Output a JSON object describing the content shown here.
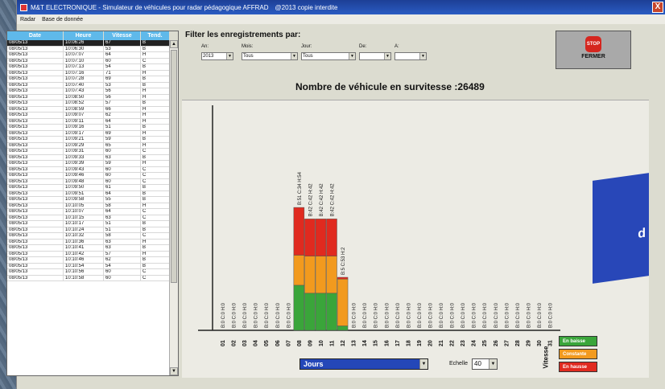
{
  "window": {
    "title": "M&T ELECTRONIQUE - Simulateur de véhicules pour radar pédagogique AFFRAD",
    "copyright": "@2013 copie interdite",
    "close": "X"
  },
  "menu": {
    "items": [
      "Radar",
      "Base de donnée"
    ]
  },
  "table": {
    "headers": [
      "Date",
      "Heure",
      "Vitesse",
      "Tend."
    ],
    "rows": [
      [
        "08/05/13",
        "10:06:26",
        "67",
        "B"
      ],
      [
        "08/05/13",
        "10:06:30",
        "53",
        "B"
      ],
      [
        "08/05/13",
        "10:07:07",
        "64",
        "H"
      ],
      [
        "08/05/13",
        "10:07:10",
        "60",
        "C"
      ],
      [
        "08/05/13",
        "10:07:13",
        "54",
        "B"
      ],
      [
        "08/05/13",
        "10:07:16",
        "71",
        "H"
      ],
      [
        "08/05/13",
        "10:07:28",
        "69",
        "B"
      ],
      [
        "08/05/13",
        "10:07:40",
        "53",
        "B"
      ],
      [
        "08/05/13",
        "10:07:43",
        "56",
        "H"
      ],
      [
        "08/05/13",
        "10:08:50",
        "56",
        "H"
      ],
      [
        "08/05/13",
        "10:08:52",
        "57",
        "B"
      ],
      [
        "08/05/13",
        "10:08:59",
        "66",
        "H"
      ],
      [
        "08/05/13",
        "10:09:07",
        "62",
        "H"
      ],
      [
        "08/05/13",
        "10:09:11",
        "64",
        "H"
      ],
      [
        "08/05/13",
        "10:09:16",
        "51",
        "B"
      ],
      [
        "08/05/13",
        "10:09:17",
        "69",
        "H"
      ],
      [
        "08/05/13",
        "10:09:21",
        "59",
        "B"
      ],
      [
        "08/05/13",
        "10:09:29",
        "65",
        "H"
      ],
      [
        "08/05/13",
        "10:09:31",
        "60",
        "C"
      ],
      [
        "08/05/13",
        "10:09:33",
        "63",
        "B"
      ],
      [
        "08/05/13",
        "10:09:39",
        "59",
        "H"
      ],
      [
        "08/05/13",
        "10:09:43",
        "60",
        "C"
      ],
      [
        "08/05/13",
        "10:09:46",
        "60",
        "C"
      ],
      [
        "08/05/13",
        "10:09:48",
        "60",
        "C"
      ],
      [
        "08/05/13",
        "10:09:50",
        "61",
        "B"
      ],
      [
        "08/05/13",
        "10:09:51",
        "64",
        "B"
      ],
      [
        "08/05/13",
        "10:09:58",
        "55",
        "B"
      ],
      [
        "08/05/13",
        "10:10:05",
        "58",
        "H"
      ],
      [
        "08/05/13",
        "10:10:07",
        "64",
        "C"
      ],
      [
        "08/05/13",
        "10:10:15",
        "63",
        "C"
      ],
      [
        "08/05/13",
        "10:10:17",
        "51",
        "B"
      ],
      [
        "08/05/13",
        "10:10:24",
        "51",
        "B"
      ],
      [
        "08/05/13",
        "10:10:32",
        "58",
        "C"
      ],
      [
        "08/05/13",
        "10:10:36",
        "63",
        "H"
      ],
      [
        "08/05/13",
        "10:10:41",
        "63",
        "B"
      ],
      [
        "08/05/13",
        "10:10:42",
        "57",
        "H"
      ],
      [
        "08/05/13",
        "10:10:46",
        "62",
        "B"
      ],
      [
        "08/05/13",
        "10:10:54",
        "54",
        "B"
      ],
      [
        "08/05/13",
        "10:10:56",
        "60",
        "C"
      ],
      [
        "08/05/13",
        "10:10:58",
        "60",
        "C"
      ]
    ]
  },
  "filter": {
    "title": "Filter les enregistrements par:",
    "labels": {
      "an": "An:",
      "mois": "Mois:",
      "jour": "Jour:",
      "de": "De:",
      "a": "A:"
    },
    "values": {
      "an": "2013",
      "mois": "Tous",
      "jour": "Tous",
      "de": "",
      "a": ""
    }
  },
  "stop_button": {
    "icon_text": "STOP",
    "label": "FERMER"
  },
  "headline": "Nombre de véhicule en survitesse :26489",
  "bottom": {
    "period": "Jours",
    "scale_label": "Echelle",
    "scale_value": "40"
  },
  "legend": {
    "title": "Vitesse",
    "items": [
      {
        "label": "En baisse",
        "color": "#3aa53a"
      },
      {
        "label": "Constante",
        "color": "#f29a1e"
      },
      {
        "label": "En hausse",
        "color": "#e02a1f"
      }
    ]
  },
  "banner_text": "d",
  "chart_data": {
    "type": "bar",
    "categories": [
      "01",
      "02",
      "03",
      "04",
      "05",
      "06",
      "07",
      "08",
      "09",
      "10",
      "11",
      "12",
      "13",
      "14",
      "15",
      "16",
      "17",
      "18",
      "19",
      "20",
      "21",
      "22",
      "23",
      "24",
      "25",
      "26",
      "27",
      "28",
      "29",
      "30",
      "31"
    ],
    "series": [
      {
        "name": "En baisse",
        "color": "#3aa53a",
        "values": [
          0,
          0,
          0,
          0,
          0,
          0,
          0,
          51,
          42,
          42,
          42,
          5,
          0,
          0,
          0,
          0,
          0,
          0,
          0,
          0,
          0,
          0,
          0,
          0,
          0,
          0,
          0,
          0,
          0,
          0,
          0
        ]
      },
      {
        "name": "Constante",
        "color": "#f29a1e",
        "values": [
          0,
          0,
          0,
          0,
          0,
          0,
          0,
          34,
          42,
          42,
          42,
          53,
          0,
          0,
          0,
          0,
          0,
          0,
          0,
          0,
          0,
          0,
          0,
          0,
          0,
          0,
          0,
          0,
          0,
          0,
          0
        ]
      },
      {
        "name": "En hausse",
        "color": "#e02a1f",
        "values": [
          0,
          0,
          0,
          0,
          0,
          0,
          0,
          54,
          42,
          42,
          42,
          2,
          0,
          0,
          0,
          0,
          0,
          0,
          0,
          0,
          0,
          0,
          0,
          0,
          0,
          0,
          0,
          0,
          0,
          0,
          0
        ]
      }
    ],
    "bar_labels": [
      "B:0 C:0 H:0",
      "B:0 C:0 H:0",
      "B:0 C:0 H:0",
      "B:0 C:0 H:0",
      "B:0 C:0 H:0",
      "B:0 C:0 H:0",
      "B:0 C:0 H:0",
      "B:51 C:34 H:54",
      "B:42 C:42 H:42",
      "B:42 C:42 H:42",
      "B:42 C:42 H:42",
      "B:5 C:53 H:2",
      "B:0 C:0 H:0",
      "B:0 C:0 H:0",
      "B:0 C:0 H:0",
      "B:0 C:0 H:0",
      "B:0 C:0 H:0",
      "B:0 C:0 H:0",
      "B:0 C:0 H:0",
      "B:0 C:0 H:0",
      "B:0 C:0 H:0",
      "B:0 C:0 H:0",
      "B:0 C:0 H:0",
      "B:0 C:0 H:0",
      "B:0 C:0 H:0",
      "B:0 C:0 H:0",
      "B:0 C:0 H:0",
      "B:0 C:0 H:0",
      "B:0 C:0 H:0",
      "B:0 C:0 H:0",
      "B:0 C:0 H:0"
    ],
    "ylabel": "Vitesse",
    "grid": false,
    "legend": "bottom-right"
  }
}
